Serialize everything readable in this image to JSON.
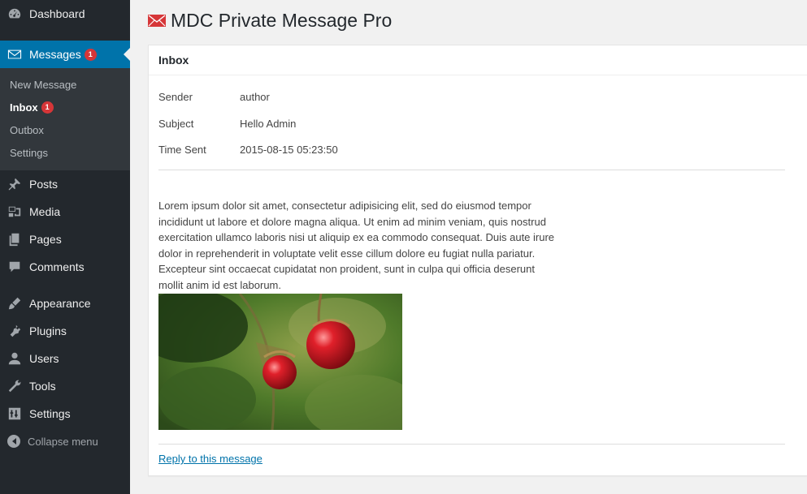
{
  "sidebar": {
    "dashboard": "Dashboard",
    "messages": "Messages",
    "messages_badge": "1",
    "submenu": {
      "new_message": "New Message",
      "inbox": "Inbox",
      "inbox_badge": "1",
      "outbox": "Outbox",
      "settings": "Settings"
    },
    "posts": "Posts",
    "media": "Media",
    "pages": "Pages",
    "comments": "Comments",
    "appearance": "Appearance",
    "plugins": "Plugins",
    "users": "Users",
    "tools": "Tools",
    "settings": "Settings",
    "collapse": "Collapse menu"
  },
  "page": {
    "title": "MDC Private Message Pro",
    "panel_title": "Inbox"
  },
  "message": {
    "sender_label": "Sender",
    "sender": "author",
    "subject_label": "Subject",
    "subject": "Hello Admin",
    "time_label": "Time Sent",
    "time": "2015-08-15 05:23:50",
    "body": "Lorem ipsum dolor sit amet, consectetur adipisicing elit, sed do eiusmod tempor incididunt ut labore et dolore magna aliqua. Ut enim ad minim veniam, quis nostrud exercitation ullamco laboris nisi ut aliquip ex ea commodo consequat. Duis aute irure dolor in reprehenderit in voluptate velit esse cillum dolore eu fugiat nulla pariatur. Excepteur sint occaecat cupidatat non proident, sunt in culpa qui officia deserunt mollit anim id est laborum.",
    "reply_link": "Reply to this message"
  },
  "colors": {
    "sidebar_bg": "#23282d",
    "submenu_bg": "#32373c",
    "accent": "#0073aa",
    "badge": "#d63638",
    "envelope": "#d63638"
  }
}
